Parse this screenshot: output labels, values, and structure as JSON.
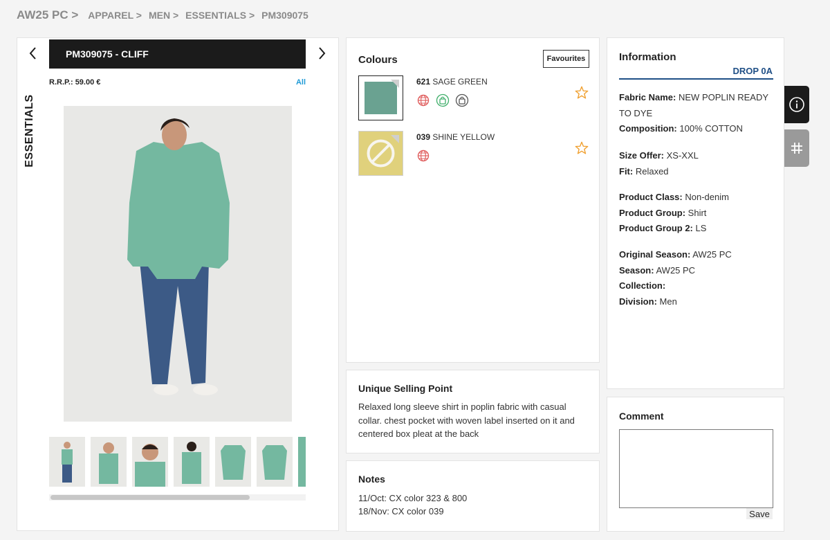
{
  "breadcrumb": {
    "root": "AW25 PC >",
    "items": [
      "APPAREL >",
      "MEN >",
      "ESSENTIALS >",
      "PM309075"
    ]
  },
  "product": {
    "title": "PM309075 - CLIFF",
    "rrp": "R.R.P.: 59.00 €",
    "all_link": "All",
    "category_label": "ESSENTIALS",
    "thumbnail_count": 7
  },
  "colours": {
    "title": "Colours",
    "favourites_button": "Favourites",
    "items": [
      {
        "code": "621",
        "name": "SAGE GREEN",
        "hex": "#6aa291",
        "icons": [
          "globe-icon",
          "shopping-bag-icon",
          "lock-bag-icon"
        ]
      },
      {
        "code": "039",
        "name": "SHINE YELLOW",
        "hex": "#e0d17c",
        "icons": [
          "globe-icon"
        ]
      }
    ]
  },
  "usp": {
    "title": "Unique Selling Point",
    "text": "Relaxed long sleeve shirt in poplin fabric with casual collar. chest pocket with woven label inserted on it and centered box pleat at the back"
  },
  "notes": {
    "title": "Notes",
    "lines": [
      "11/Oct: CX color 323 & 800",
      "18/Nov: CX color 039"
    ]
  },
  "information": {
    "title": "Information",
    "drop": "DROP 0A",
    "fabric_name_label": "Fabric Name:",
    "fabric_name": "NEW POPLIN READY TO DYE",
    "composition_label": "Composition:",
    "composition": "100% COTTON",
    "size_offer_label": "Size Offer:",
    "size_offer": "XS-XXL",
    "fit_label": "Fit:",
    "fit": "Relaxed",
    "product_class_label": "Product Class:",
    "product_class": "Non-denim",
    "product_group_label": "Product Group:",
    "product_group": "Shirt",
    "product_group_2_label": "Product Group 2:",
    "product_group_2": "LS",
    "original_season_label": "Original Season:",
    "original_season": "AW25 PC",
    "season_label": "Season:",
    "season": "AW25 PC",
    "collection_label": "Collection:",
    "collection": "",
    "division_label": "Division:",
    "division": "Men"
  },
  "comment": {
    "title": "Comment",
    "value": "",
    "save_button": "Save"
  },
  "colors": {
    "accent_blue": "#1f4f86",
    "link_blue": "#1e9ad6",
    "star_orange": "#f0a030",
    "shirt_green": "#74b8a0"
  }
}
